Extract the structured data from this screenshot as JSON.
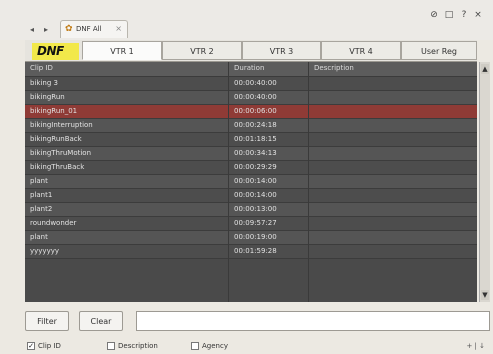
{
  "window": {
    "nav_back": "◂",
    "nav_fwd": "▸",
    "tab_icon": "gear-icon",
    "tab_title": "DNF All",
    "tab_close": "×",
    "controls": [
      "⊘",
      "□",
      "?",
      "×"
    ]
  },
  "vtr_bar": {
    "logo_text": "DNF",
    "tabs": [
      "VTR 1",
      "VTR 2",
      "VTR 3",
      "VTR 4",
      "User Reg"
    ],
    "active_index": 0
  },
  "grid": {
    "columns": [
      "Clip ID",
      "Duration",
      "Description"
    ],
    "rows": [
      {
        "clip_id": "biking 3",
        "duration": "00:00:40:00",
        "description": ""
      },
      {
        "clip_id": "bikingRun",
        "duration": "00:00:40:00",
        "description": ""
      },
      {
        "clip_id": "bikingRun_01",
        "duration": "00:00:06:00",
        "description": ""
      },
      {
        "clip_id": "bikingInterruption",
        "duration": "00:00:24:18",
        "description": ""
      },
      {
        "clip_id": "bikingRunBack",
        "duration": "00:01:18:15",
        "description": ""
      },
      {
        "clip_id": "bikingThruMotion",
        "duration": "00:00:34:13",
        "description": ""
      },
      {
        "clip_id": "bikingThruBack",
        "duration": "00:00:29:29",
        "description": ""
      },
      {
        "clip_id": "plant",
        "duration": "00:00:14:00",
        "description": ""
      },
      {
        "clip_id": "plant1",
        "duration": "00:00:14:00",
        "description": ""
      },
      {
        "clip_id": "plant2",
        "duration": "00:00:13:00",
        "description": ""
      },
      {
        "clip_id": "roundwonder",
        "duration": "00:09:57:27",
        "description": ""
      },
      {
        "clip_id": "plant",
        "duration": "00:00:19:00",
        "description": ""
      },
      {
        "clip_id": "yyyyyyy",
        "duration": "00:01:59:28",
        "description": ""
      }
    ],
    "selected_index": 2,
    "colors": {
      "row": "#4d4d4d",
      "row_alt": "#555555",
      "selected": "#8f3b36",
      "text": "#e2e2e2"
    }
  },
  "scrollbar": {
    "up": "▲",
    "down": "▼"
  },
  "filter_bar": {
    "filter_label": "Filter",
    "clear_label": "Clear",
    "input_value": "",
    "input_placeholder": ""
  },
  "search_options": [
    {
      "label": "Clip ID",
      "checked": true
    },
    {
      "label": "Description",
      "checked": false
    },
    {
      "label": "Agency",
      "checked": false
    }
  ],
  "corner_label": "+ | ↓"
}
